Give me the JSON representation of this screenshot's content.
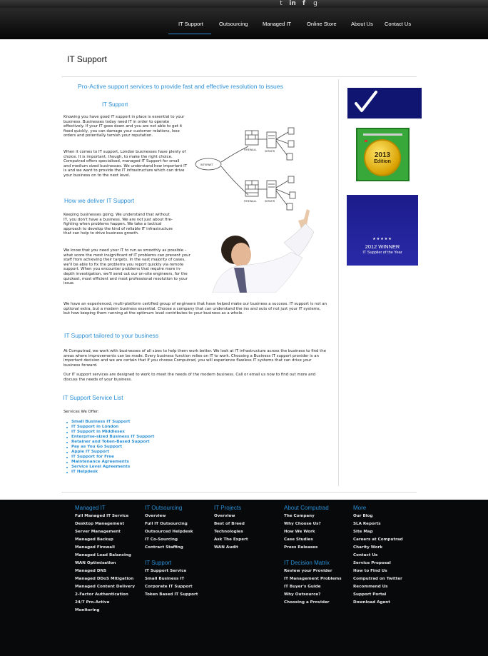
{
  "header": {
    "social_icons": [
      "twitter-icon",
      "linkedin-icon",
      "facebook-icon",
      "google-plus-icon"
    ],
    "nav": [
      "IT Support",
      "Outsourcing",
      "Managed IT",
      "Online Store",
      "About Us",
      "Contact Us"
    ],
    "active_nav": "IT Support"
  },
  "page": {
    "title": "IT Support",
    "tagline": "Pro-Active support services to provide fast and effective resolution to issues",
    "section1_heading": "IT Support",
    "section1_p1": "Knowing you have good IT support in place is essential to your business. Businesses today need IT in order to operate effectively. If your IT goes down and you are not able to get it fixed quickly, you can damage your customer relations, lose orders and potentially tarnish your reputation.",
    "section1_p2": "When it comes to IT support, London businesses have plenty of choice. It is important, though, to make the right choice. Computrad offers specialised, managed IT Support for small and medium sized businesses. We understand how important IT is and we want to provide the IT infrastructure which can drive your business on to the next level.",
    "section2_heading": "How we deliver IT Support",
    "section2_p1": "Keeping businesses going. We understand that without IT, you don't have a business. We are not just about fire-fighting when problems happen. We take a tactical approach to develop the kind of reliable IT infrastructure that can help to drive business growth.",
    "section2_p2": "We know that you need your IT to run as smoothly as possible – what score the most insignificant of IT problems can prevent your staff from achieving their targets. In the vast majority of cases, we'll be able to fix the problems you report quickly via remote support. When you encounter problems that require more in-depth investigation, we'll send out our on-site engineers, for the quickest, most efficient and most professional resolution to your issue.",
    "section2_p3": "We have an experienced, multi-platform certified group of engineers that have helped make our business a success. IT support is not an optional extra, but a modern business essential. Choose a company that can understand the ins and outs of not just your IT systems, but how keeping them running at the optimum level contributes to your business as a whole.",
    "section3_heading": "IT Support tailored to your business",
    "section3_p1": "At Computrad, we work with businesses of all sizes to help them work better. We look at IT infrastructure across the business to find the areas where improvements can be made. Every business function relies on IT to work. Choosing a Business IT support provider is an important decision and we are certain that if you choose Computrad, you will experience flawless IT systems that can drive your business forward.",
    "section3_p2": "Our IT support services are designed to work to meet the needs of the modern business. Call or email us now to find out more and discuss the needs of your business.",
    "section4_heading": "IT Support Service List",
    "services_intro": "Services We Offer:",
    "services": [
      "Small Business IT Support",
      "IT Support in London",
      "IT Support in Middlesex",
      "Enterprise-sized Business IT Support",
      "Retainer and Token-Based Support",
      "Pay as You Go Support",
      "Apple IT Support",
      "IT Support for Free",
      "Maintenance Agreements",
      "Service Level Agreements",
      "IT Helpdesk"
    ],
    "diagram_labels": [
      "INTERNET",
      "FIREWALL",
      "SERVER",
      "FIREWALL",
      "SERVER"
    ],
    "badge_edition": [
      "2013",
      "Edition"
    ],
    "badge_winner": [
      "2012 WINNER",
      "IT Supplier of the Year"
    ],
    "badge_stars": "★★★★★"
  },
  "footer": {
    "columns": [
      {
        "heading": "Managed IT",
        "items": [
          "Full Managed IT Service",
          "Desktop Management",
          "Server Management",
          "Managed Backup",
          "Managed Firewall",
          "Managed Load Balancing",
          "WAN Optimisation",
          "Managed DNS",
          "Managed DDoS Mitigation",
          "Managed Content Delivery",
          "2-Factor Authentication",
          "24/7 Pro-Active",
          "Monitoring"
        ]
      },
      {
        "heading": "IT Outsourcing",
        "items": [
          "Overview",
          "Full IT Outsourcing",
          "Outsourced Helpdesk",
          "IT Co-Sourcing",
          "Contract Staffing"
        ]
      },
      {
        "heading": "IT Support",
        "items": [
          "IT Support Service",
          "Small Business IT",
          "Corporate IT Support",
          "Token Based IT Support"
        ]
      },
      {
        "heading": "IT Projects",
        "items": [
          "Overview",
          "Best of Breed",
          "Technologies",
          "Ask The Expert",
          "WAN Audit"
        ]
      },
      {
        "heading": "About Computrad",
        "items": [
          "The Company",
          "Why Choose Us?",
          "How We Work",
          "Case Studies",
          "Press Releases"
        ]
      },
      {
        "heading": "IT Decision Matrix",
        "items": [
          "Review your Provider",
          "IT Management Problems",
          "IT Buyer's Guide",
          "Why Outsource?",
          "Choosing a Provider"
        ]
      },
      {
        "heading": "More",
        "items": [
          "Our Blog",
          "SLA Reports",
          "Site Map",
          "Careers at Computrad",
          "Charity Work",
          "Contact Us",
          "Service Proposal",
          "How to Find Us",
          "Computrad on Twitter",
          "Recommend Us",
          "Support Portal",
          "Download Agent"
        ]
      }
    ]
  }
}
